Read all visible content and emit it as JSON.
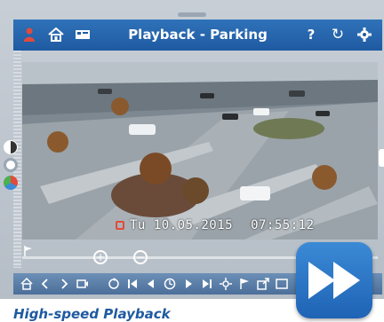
{
  "header": {
    "title": "Playback - Parking",
    "left_icons": [
      "person-icon",
      "home-icon",
      "camera-view-icon"
    ],
    "right_icons": [
      "help-icon",
      "refresh-icon",
      "settings-icon"
    ],
    "help_glyph": "?",
    "refresh_glyph": "↻"
  },
  "video": {
    "date_text": "Tu 10.05.2015",
    "time_text": "07:55:12",
    "overlay_colors": {
      "recording": "#e24a3b",
      "text": "#ffffff"
    }
  },
  "side_icons": [
    "contrast-icon",
    "brightness-icon",
    "color-wheel-icon"
  ],
  "timeline": {
    "zoom_in_glyph": "+",
    "zoom_out_glyph": "−"
  },
  "toolbar": {
    "buttons": [
      "home-icon",
      "prev-icon",
      "next-icon",
      "video-icon",
      "loop-icon",
      "skip-back-icon",
      "step-back-icon",
      "clock-icon",
      "step-forward-icon",
      "skip-forward-icon",
      "speed-icon",
      "marker-icon",
      "export-icon",
      "fullscreen-icon"
    ]
  },
  "caption": "High-speed Playback",
  "accent_color": "#1f5aa1"
}
